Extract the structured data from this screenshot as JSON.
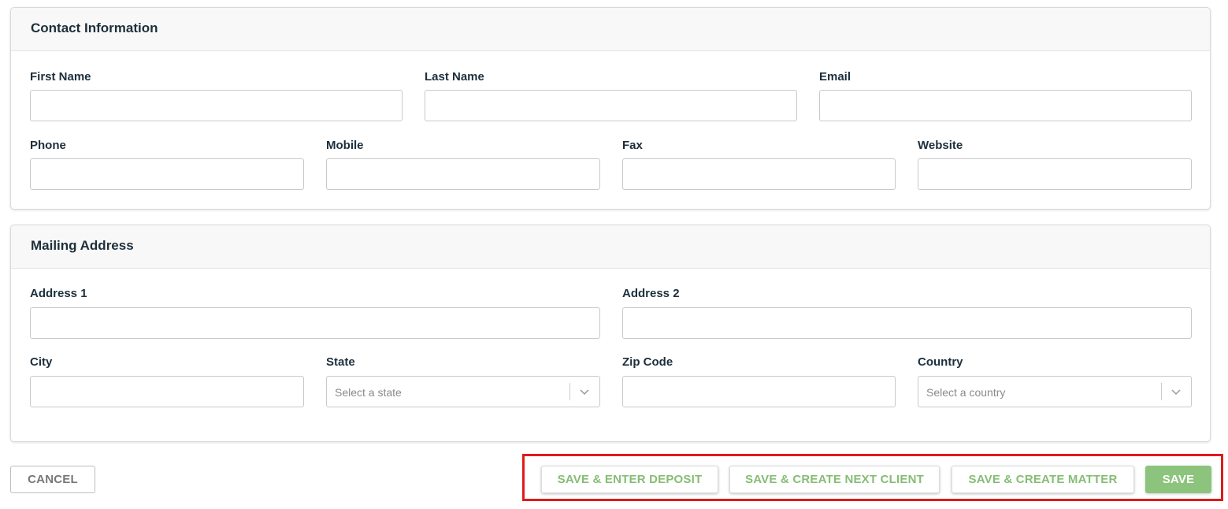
{
  "contact": {
    "title": "Contact Information",
    "fields": {
      "first_name": {
        "label": "First Name",
        "value": ""
      },
      "last_name": {
        "label": "Last Name",
        "value": ""
      },
      "email": {
        "label": "Email",
        "value": ""
      },
      "phone": {
        "label": "Phone",
        "value": ""
      },
      "mobile": {
        "label": "Mobile",
        "value": ""
      },
      "fax": {
        "label": "Fax",
        "value": ""
      },
      "website": {
        "label": "Website",
        "value": ""
      }
    }
  },
  "mailing": {
    "title": "Mailing Address",
    "fields": {
      "address1": {
        "label": "Address 1",
        "value": ""
      },
      "address2": {
        "label": "Address 2",
        "value": ""
      },
      "city": {
        "label": "City",
        "value": ""
      },
      "state": {
        "label": "State",
        "placeholder": "Select a state"
      },
      "zip": {
        "label": "Zip Code",
        "value": ""
      },
      "country": {
        "label": "Country",
        "placeholder": "Select a country"
      }
    }
  },
  "actions": {
    "cancel": "CANCEL",
    "save_enter_deposit": "SAVE & ENTER DEPOSIT",
    "save_create_next_client": "SAVE & CREATE NEXT CLIENT",
    "save_create_matter": "SAVE & CREATE MATTER",
    "save": "SAVE"
  },
  "colors": {
    "accent_green": "#8dc47d",
    "highlight_red": "#e01b1b",
    "label_text": "#1d2f3b"
  },
  "icons": {
    "select_chevron": "chevron-down-icon"
  }
}
